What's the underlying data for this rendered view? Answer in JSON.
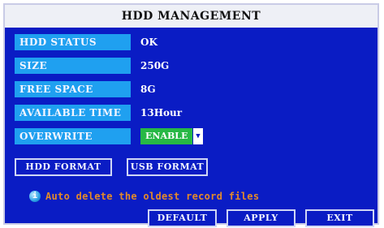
{
  "window": {
    "title": "HDD MANAGEMENT"
  },
  "fields": {
    "hdd_status": {
      "label": "HDD STATUS",
      "value": "OK"
    },
    "size": {
      "label": "SIZE",
      "value": "250G"
    },
    "free_space": {
      "label": "FREE SPACE",
      "value": "8G"
    },
    "available_time": {
      "label": "AVAILABLE TIME",
      "value": "13Hour"
    },
    "overwrite": {
      "label": "OVERWRITE",
      "value": "ENABLE"
    }
  },
  "actions": {
    "hdd_format": "HDD FORMAT",
    "usb_format": "USB FORMAT",
    "default": "DEFAULT",
    "apply": "APPLY",
    "exit": "EXIT"
  },
  "hint": {
    "icon": "info-icon",
    "text": "Auto delete the oldest record files"
  },
  "colors": {
    "background": "#0a1cc4",
    "label": "#1fa0f0",
    "selected": "#27b845",
    "hint_text": "#e38a2a"
  }
}
